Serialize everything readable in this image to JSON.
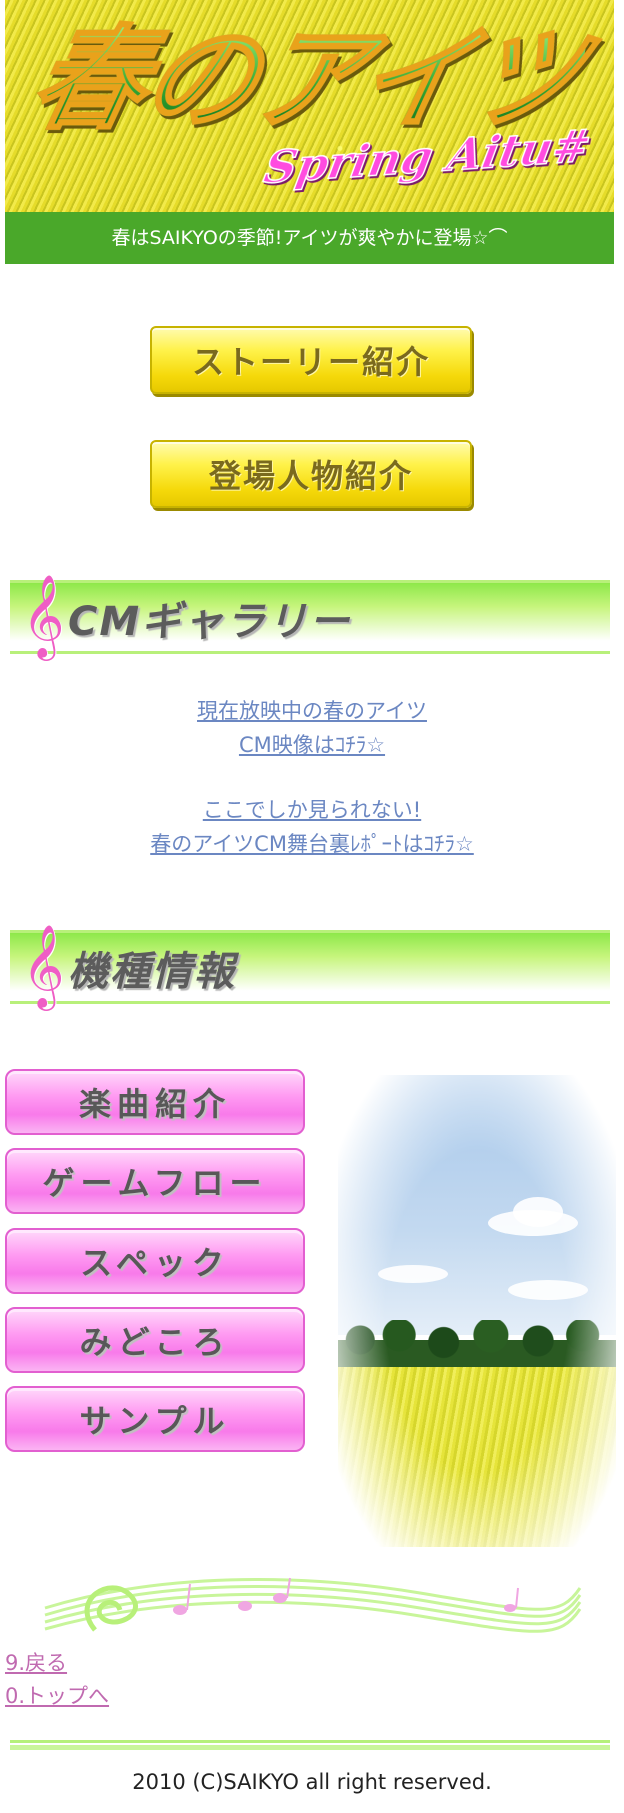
{
  "header": {
    "logo_title": "春のアイツ",
    "logo_subtitle": "Spring Aitu#",
    "tagline": "春はSAIKYOの季節!アイツが爽やかに登場☆⌒"
  },
  "main_buttons": {
    "story": "ストーリー紹介",
    "characters": "登場人物紹介"
  },
  "cm_gallery": {
    "section_title": "CMギャラリー",
    "link1_line1": "現在放映中の春のアイツ",
    "link1_line2": "CM映像はｺﾁﾗ☆",
    "link2_line1": "ここでしか見られない!",
    "link2_line2": "春のアイツCM舞台裏ﾚﾎﾟｰﾄはｺﾁﾗ☆"
  },
  "machine_info": {
    "section_title": "機種情報",
    "menu": [
      "楽曲紹介",
      "ゲームフロー",
      "スペック",
      "みどころ",
      "サンプル"
    ]
  },
  "icons": {
    "section_clef": "treble-clef-icon",
    "decor": "music-staff-icon"
  },
  "footer": {
    "back": "9.戻る",
    "top": "0.トップへ",
    "copyright": "2010 (C)SAIKYO all right reserved."
  },
  "colors": {
    "header_green": "#4aa82a",
    "link_blue": "#6b87c2",
    "footer_link_pink": "#c06ab0",
    "accent_pink": "#ef5ec5"
  }
}
